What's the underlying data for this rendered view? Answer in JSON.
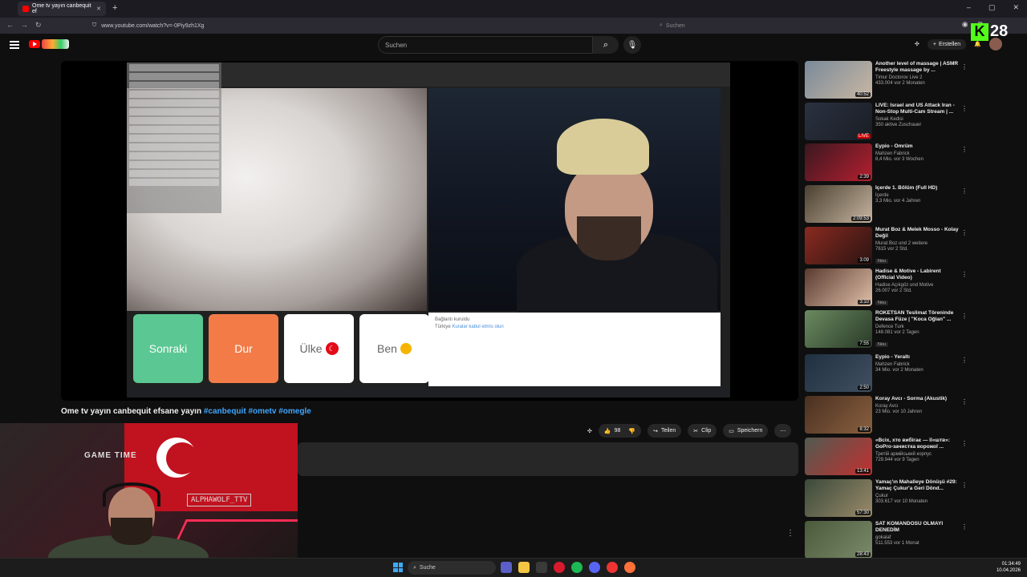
{
  "browser": {
    "tab_title": "Ome tv yayın canbequit ef",
    "url": "www.youtube.com/watch?v=-0Piy9zh1Xg",
    "search_placeholder": "Suchen"
  },
  "youtube_header": {
    "search_placeholder": "Suchen",
    "create_label": "Erstellen"
  },
  "kick_overlay": {
    "viewer_count": "28"
  },
  "omegle_ui": {
    "next_label": "Sonraki",
    "stop_label": "Dur",
    "country_label": "Ülke",
    "me_label": "Ben",
    "chat_connected": "Bağlantı kuruldu",
    "chat_country": "Türkiye",
    "chat_link": "Kuralar kabul etmis olun"
  },
  "video": {
    "title_text": "Ome tv yayın canbequit efsane yayın",
    "hashtags": [
      "#canbequit",
      "#ometv",
      "#omegle"
    ],
    "likes": "98",
    "share_label": "Teilen",
    "clip_label": "Clip",
    "save_label": "Speichern"
  },
  "webcam_overlay": {
    "name_tag": "ALPHAWOLF_TTV",
    "poster_text": "GAME TIME"
  },
  "recommendations": [
    {
      "title": "Another level of massage | ASMR Freestyle massage by ...",
      "channel": "Timur Doctorov Live 2",
      "meta": "433.004  vor 2 Monaten",
      "duration": "40:52",
      "colors": [
        "#7a8a99",
        "#c9b7a4"
      ]
    },
    {
      "title": "LIVE: Israel and US Attack Iran - Non-Stop Multi-Cam Stream | ...",
      "channel": "Sokak Kedisi",
      "meta": "350 aktive Zuschauer",
      "duration": "LIVE",
      "colors": [
        "#2a3140",
        "#1a1d24"
      ]
    },
    {
      "title": "Eypio - Ömrüm",
      "channel": "Mahzen Fabrick",
      "meta": "8,4 Mio.  vor 3 Wochen",
      "duration": "2:39",
      "colors": [
        "#3a1820",
        "#b51f2f"
      ]
    },
    {
      "title": "İçerde 1. Bölüm (Full HD)",
      "channel": "İçerde",
      "meta": "3,3 Mio.  vor 4 Jahren",
      "duration": "2:09:53",
      "colors": [
        "#4a4030",
        "#c6b4a0"
      ]
    },
    {
      "title": "Murat Boz & Melek Mosso - Kolay Değil",
      "channel": "Murat Boz  und 2 weitere",
      "meta": "7615  vor 2 Std.",
      "duration": "3:09",
      "new": "Neu",
      "colors": [
        "#8a2a20",
        "#2a1412"
      ]
    },
    {
      "title": "Hadise & Motive - Labirent (Official Video)",
      "channel": "Hadise Açıkgöz  und Motive",
      "meta": "26.007  vor 2 Std.",
      "duration": "3:10",
      "new": "Neu",
      "colors": [
        "#5a3a30",
        "#e0c0a8"
      ]
    },
    {
      "title": "ROKETSAN Teslimat Töreninde Devasa Füze | \"Koca Oğlan\" ...",
      "channel": "Defence Turk",
      "meta": "148.081  vor 2 Tagen",
      "duration": "7:55",
      "new": "Neu",
      "colors": [
        "#6a8a60",
        "#2a3a28"
      ]
    },
    {
      "title": "Eypio - Yeraltı",
      "channel": "Mahzen Fabrick",
      "meta": "34 Mio.  vor 2 Monaten",
      "duration": "2:50",
      "colors": [
        "#203040",
        "#405060"
      ]
    },
    {
      "title": "Koray Avcı - Sorma (Akustik)",
      "channel": "Koray Avcı",
      "meta": "23 Mio.  vor 10 Jahren",
      "duration": "8:32",
      "colors": [
        "#4a3020",
        "#8a6040"
      ]
    },
    {
      "title": "«Всіх, хто вибігає — її«штв»: GoPro-зачистка ворожої ...",
      "channel": "Третій армійський корпус",
      "meta": "729.944  vor 9 Tagen",
      "duration": "13:41",
      "colors": [
        "#505a50",
        "#c23030"
      ]
    },
    {
      "title": "Yamaç'ın Mahalleye Dönüşü #29: Yamaç Çukur'a Geri Dönd...",
      "channel": "Çukur",
      "meta": "303.617  vor 10 Monaten",
      "duration": "57:30",
      "colors": [
        "#3a4a3a",
        "#9a8a6a"
      ]
    },
    {
      "title": "SAT KOMANDOSU OLMAYI DENEDİM",
      "channel": "gokalaf",
      "meta": "511.553  vor 1 Monat",
      "duration": "28:43",
      "colors": [
        "#4a5a3a",
        "#7a8a6a"
      ]
    }
  ],
  "taskbar": {
    "search_label": "Suche",
    "time": "01:34:49",
    "date": "10.04.2026"
  }
}
